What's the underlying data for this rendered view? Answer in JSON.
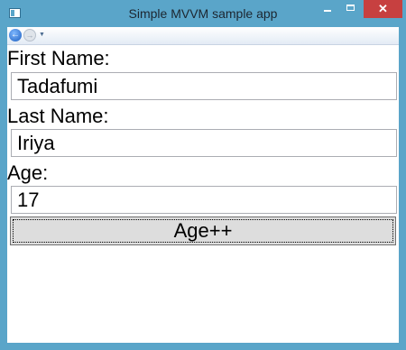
{
  "window": {
    "title": "Simple MVVM sample app",
    "controls": {
      "minimize": "minimize-icon",
      "maximize": "maximize-icon",
      "close": "✕"
    }
  },
  "nav": {
    "back_icon": "back-arrow-icon",
    "forward_icon": "forward-arrow-icon",
    "dropdown_icon": "dropdown-icon"
  },
  "form": {
    "first_name_label": "First Name:",
    "first_name_value": "Tadafumi",
    "last_name_label": "Last Name:",
    "last_name_value": "Iriya",
    "age_label": "Age:",
    "age_value": "17",
    "age_button": "Age++"
  },
  "colors": {
    "frame": "#5aa5c9",
    "close": "#c74040",
    "button_face": "#dddddd"
  }
}
